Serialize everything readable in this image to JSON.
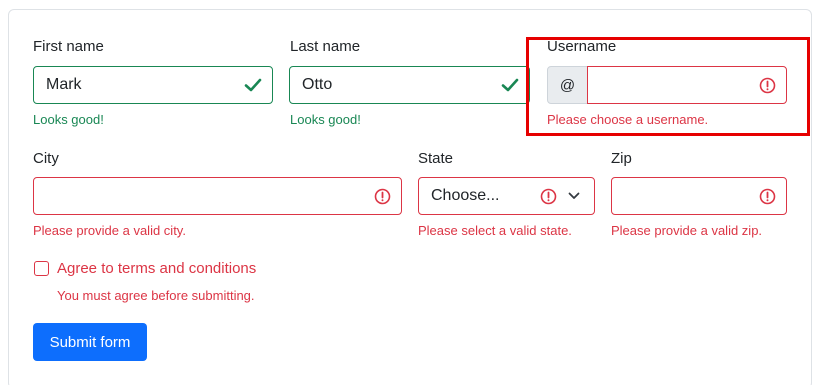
{
  "form": {
    "first_name": {
      "label": "First name",
      "value": "Mark",
      "feedback": "Looks good!"
    },
    "last_name": {
      "label": "Last name",
      "value": "Otto",
      "feedback": "Looks good!"
    },
    "username": {
      "label": "Username",
      "prefix": "@",
      "value": "",
      "feedback": "Please choose a username."
    },
    "city": {
      "label": "City",
      "value": "",
      "feedback": "Please provide a valid city."
    },
    "state": {
      "label": "State",
      "selected": "Choose...",
      "feedback": "Please select a valid state."
    },
    "zip": {
      "label": "Zip",
      "value": "",
      "feedback": "Please provide a valid zip."
    },
    "terms": {
      "label": "Agree to terms and conditions",
      "checked": false,
      "feedback": "You must agree before submitting."
    },
    "submit_label": "Submit form"
  },
  "colors": {
    "valid": "#198754",
    "invalid": "#dc3545",
    "primary": "#0d6efd",
    "highlight": "#e60000"
  }
}
